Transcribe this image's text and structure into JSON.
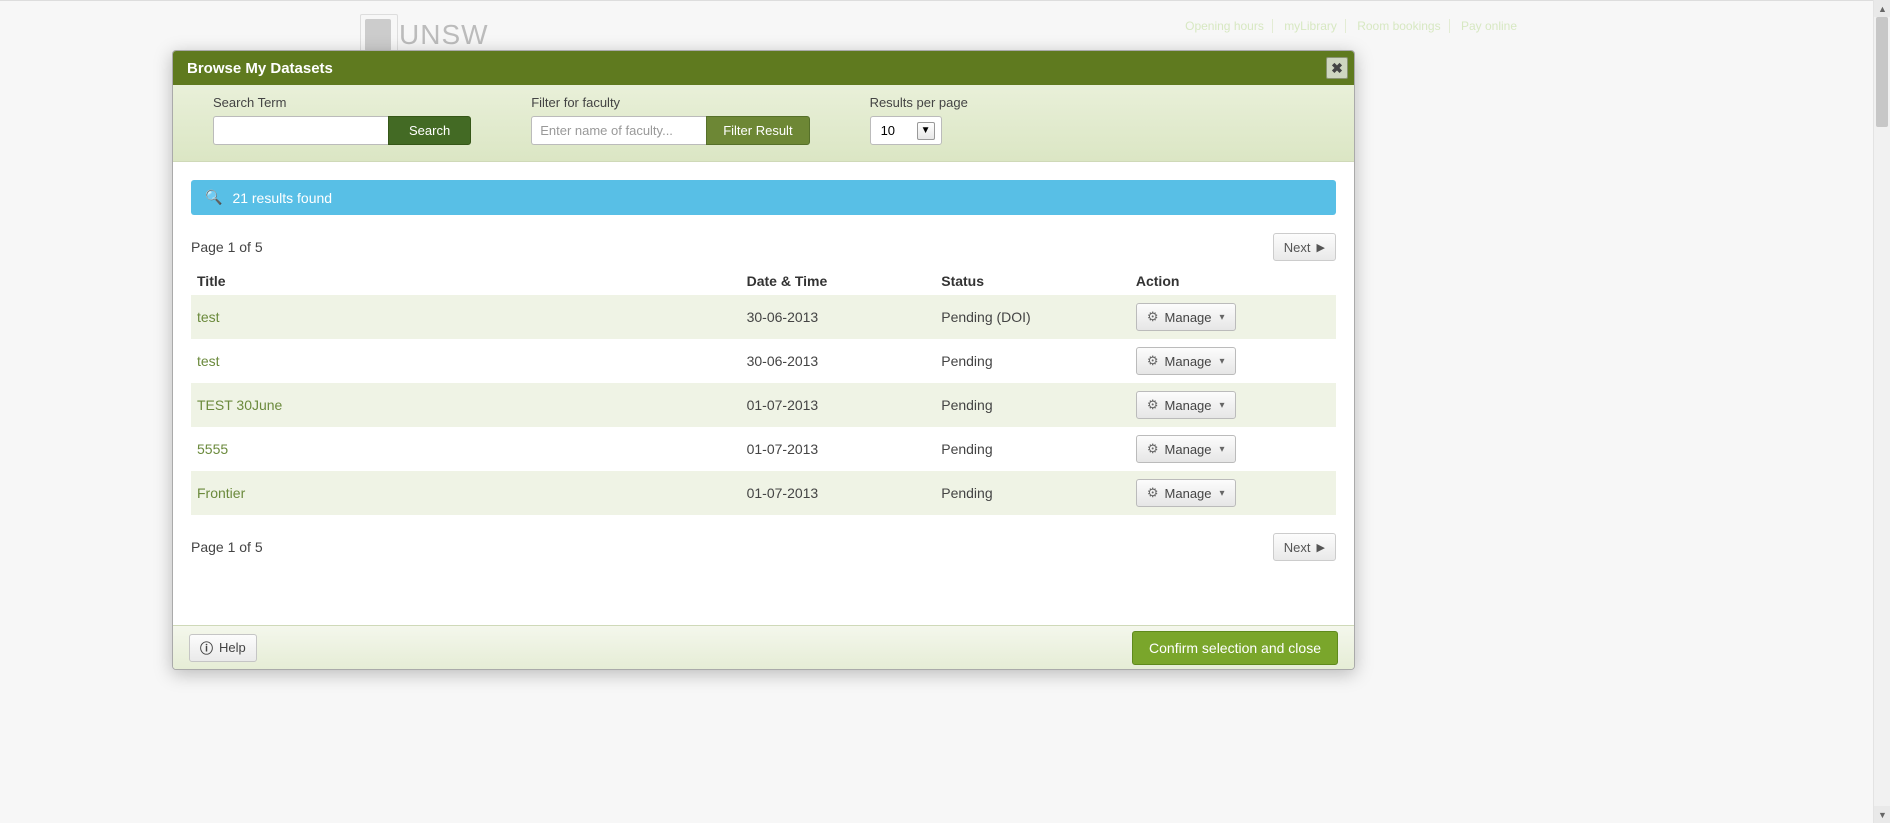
{
  "background": {
    "brand_text": "UNSW",
    "top_links": [
      "Opening hours",
      "myLibrary",
      "Room bookings",
      "Pay online"
    ]
  },
  "modal": {
    "title": "Browse My Datasets",
    "close_glyph": "✖"
  },
  "filters": {
    "search_label": "Search Term",
    "search_button": "Search",
    "faculty_label": "Filter for faculty",
    "faculty_placeholder": "Enter name of faculty...",
    "faculty_button": "Filter Result",
    "perpage_label": "Results per page",
    "perpage_value": "10"
  },
  "result_banner": "21 results found",
  "pagination": {
    "page_text": "Page 1 of 5",
    "next_label": "Next"
  },
  "table": {
    "headers": {
      "title": "Title",
      "datetime": "Date & Time",
      "status": "Status",
      "action": "Action"
    },
    "manage_label": "Manage",
    "rows": [
      {
        "title": "test",
        "datetime": "30-06-2013",
        "status": "Pending (DOI)",
        "alt": true
      },
      {
        "title": "test",
        "datetime": "30-06-2013",
        "status": "Pending",
        "alt": false
      },
      {
        "title": "TEST 30June",
        "datetime": "01-07-2013",
        "status": "Pending",
        "alt": true
      },
      {
        "title": "5555",
        "datetime": "01-07-2013",
        "status": "Pending",
        "alt": false
      },
      {
        "title": "Frontier",
        "datetime": "01-07-2013",
        "status": "Pending",
        "alt": true
      }
    ]
  },
  "footer": {
    "help_label": "Help",
    "confirm_label": "Confirm selection and close"
  }
}
